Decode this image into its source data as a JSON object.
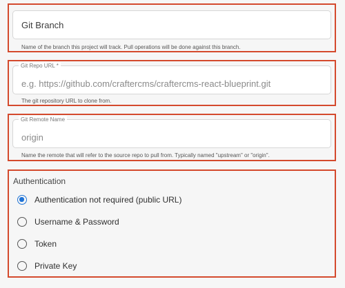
{
  "git_branch": {
    "placeholder": "Git Branch",
    "value": "",
    "helper": "Name of the branch this project will track. Pull operations will be done against this branch."
  },
  "git_repo_url": {
    "label": "Git Repo URL *",
    "placeholder": "e.g. https://github.com/craftercms/craftercms-react-blueprint.git",
    "value": "",
    "helper": "The git repository URL to clone from."
  },
  "git_remote_name": {
    "label": "Git Remote Name",
    "placeholder": "origin",
    "value": "",
    "helper": "Name the remote that will refer to the source repo to pull from. Typically named \"upstream\" or \"origin\"."
  },
  "authentication": {
    "title": "Authentication",
    "selected_index": 0,
    "options": [
      {
        "label": "Authentication not required (public URL)",
        "checked": true
      },
      {
        "label": "Username & Password",
        "checked": false
      },
      {
        "label": "Token",
        "checked": false
      },
      {
        "label": "Private Key",
        "checked": false
      }
    ]
  },
  "colors": {
    "highlight_border": "#d4492c",
    "radio_selected": "#1f73d6",
    "background": "#f6f6f6"
  }
}
